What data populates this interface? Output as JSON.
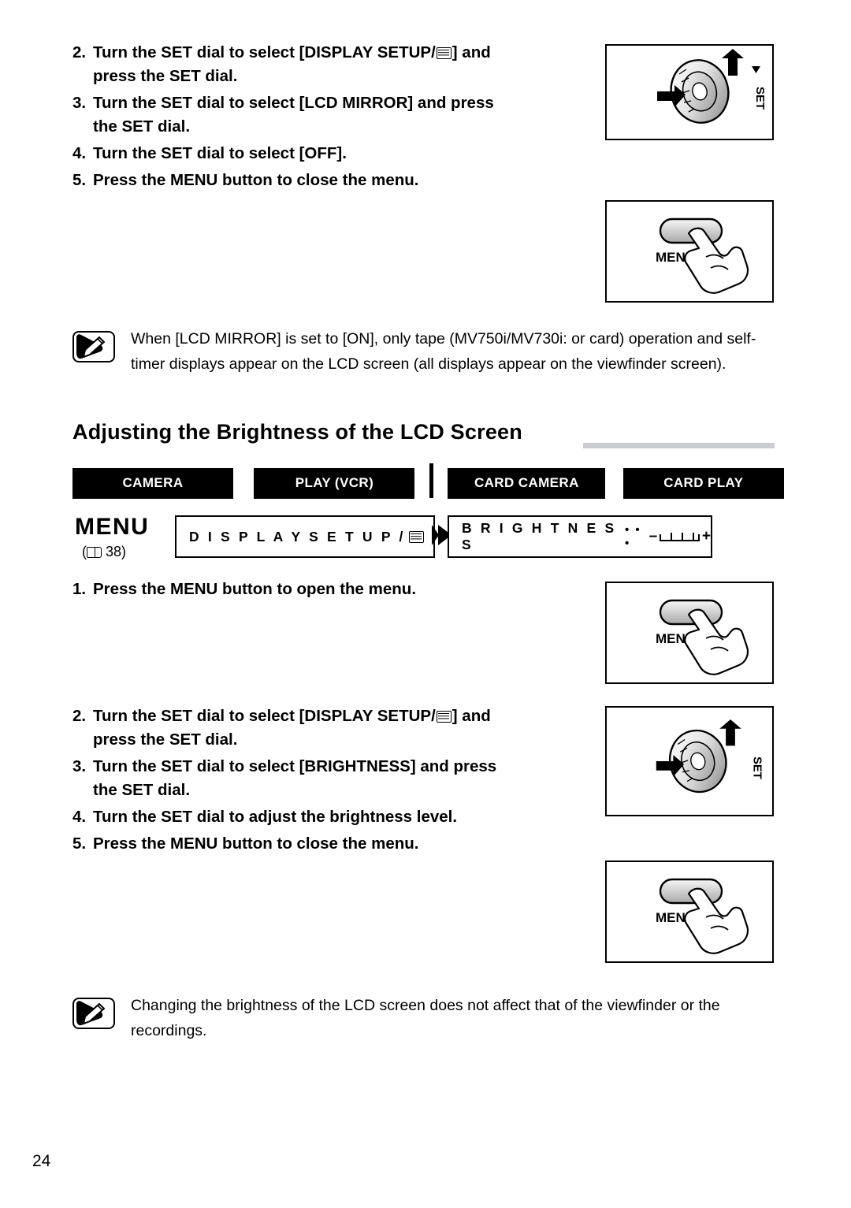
{
  "page_number": "24",
  "top_steps": [
    {
      "num": "2.",
      "text_before": "Turn the SET dial to select [DISPLAY SETUP/",
      "icon": "display-setup-icon",
      "text_after": "] and",
      "line2": "press the SET dial."
    },
    {
      "num": "3.",
      "text_before": "Turn the SET dial to select [LCD MIRROR] and press",
      "line2": "the SET dial."
    },
    {
      "num": "4.",
      "text_before": "Turn the SET dial to select [OFF]."
    },
    {
      "num": "5.",
      "text_before": "Press the MENU button to close the menu."
    }
  ],
  "note_top": "When [LCD MIRROR] is set to [ON], only tape (MV750i/MV730i: or card) operation and self-timer displays appear on the LCD screen (all displays appear on the viewfinder screen).",
  "heading": "Adjusting the Brightness of the LCD Screen",
  "modes": [
    {
      "label": "CAMERA",
      "name": "mode-camera"
    },
    {
      "label": "PLAY (VCR)",
      "name": "mode-play-vcr"
    },
    {
      "label": "CARD CAMERA",
      "name": "mode-card-camera"
    },
    {
      "label": "CARD PLAY",
      "name": "mode-card-play"
    }
  ],
  "menu_block": {
    "label": "MENU",
    "page_ref": "38",
    "osd_left": "D I S P L A Y   S E T U P /",
    "osd_right": "B R I G H T N E S S",
    "osd_right_dots": "• • •",
    "osd_minus": "–",
    "osd_plus": "+"
  },
  "bottom_steps": [
    {
      "num": "1.",
      "text_before": "Press the MENU button to open the menu."
    },
    {
      "num": "2.",
      "text_before": "Turn the SET dial to select [DISPLAY SETUP/",
      "icon": "display-setup-icon",
      "text_after": "] and",
      "line2": "press the SET dial."
    },
    {
      "num": "3.",
      "text_before": "Turn the SET dial to select [BRIGHTNESS] and press",
      "line2": "the SET dial."
    },
    {
      "num": "4.",
      "text_before": "Turn the SET dial to adjust the brightness level."
    },
    {
      "num": "5.",
      "text_before": "Press the MENU button to close the menu."
    }
  ],
  "note_bottom": "Changing the brightness of the LCD screen does not affect that of the viewfinder or the recordings.",
  "illustrations": [
    {
      "name": "illustration-set-dial-top",
      "type": "set-dial",
      "set_label": "SET"
    },
    {
      "name": "illustration-menu-button-top",
      "type": "menu-button",
      "button_label": "MENU"
    },
    {
      "name": "illustration-menu-button-open",
      "type": "menu-button",
      "button_label": "MENU"
    },
    {
      "name": "illustration-set-dial-bottom",
      "type": "set-dial",
      "set_label": "SET"
    },
    {
      "name": "illustration-menu-button-close",
      "type": "menu-button",
      "button_label": "MENU"
    }
  ],
  "colors": {
    "heading_rule": "#c9ccd1",
    "mode_tab_bg": "#000000",
    "mode_tab_text": "#ffffff"
  }
}
